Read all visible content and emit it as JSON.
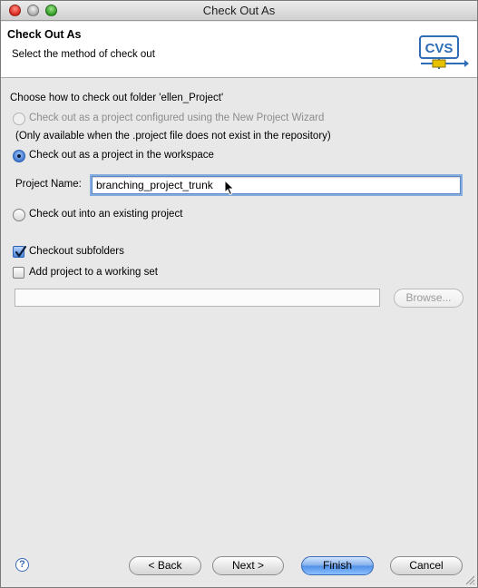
{
  "window": {
    "title": "Check Out As"
  },
  "banner": {
    "title": "Check Out As",
    "description": "Select the method of check out",
    "logo_text": "CVS"
  },
  "options": {
    "heading": "Choose how to check out folder 'ellen_Project'",
    "wizard_label": "Check out as a project configured using the New Project Wizard",
    "wizard_note": "(Only available when the .project file does not exist in the repository)",
    "workspace_label": "Check out as a project in the workspace",
    "project_name_label": "Project Name:",
    "project_name_value": "branching_project_trunk",
    "existing_label": "Check out into an existing project"
  },
  "settings": {
    "subfolders_label": "Checkout subfolders",
    "subfolders_checked": true,
    "working_set_label": "Add project to a working set",
    "working_set_checked": false,
    "working_set_value": "",
    "browse_label": "Browse..."
  },
  "footer": {
    "help_glyph": "?",
    "back_label": "< Back",
    "next_label": "Next >",
    "finish_label": "Finish",
    "cancel_label": "Cancel"
  },
  "colors": {
    "accent": "#3a73cf",
    "logo_blue": "#2f6db6",
    "logo_yellow": "#e6c200"
  },
  "icons": {
    "help": "help-icon",
    "logo": "cvs-logo-icon",
    "pointer": "mouse-pointer-icon",
    "grip": "resize-grip-icon"
  }
}
